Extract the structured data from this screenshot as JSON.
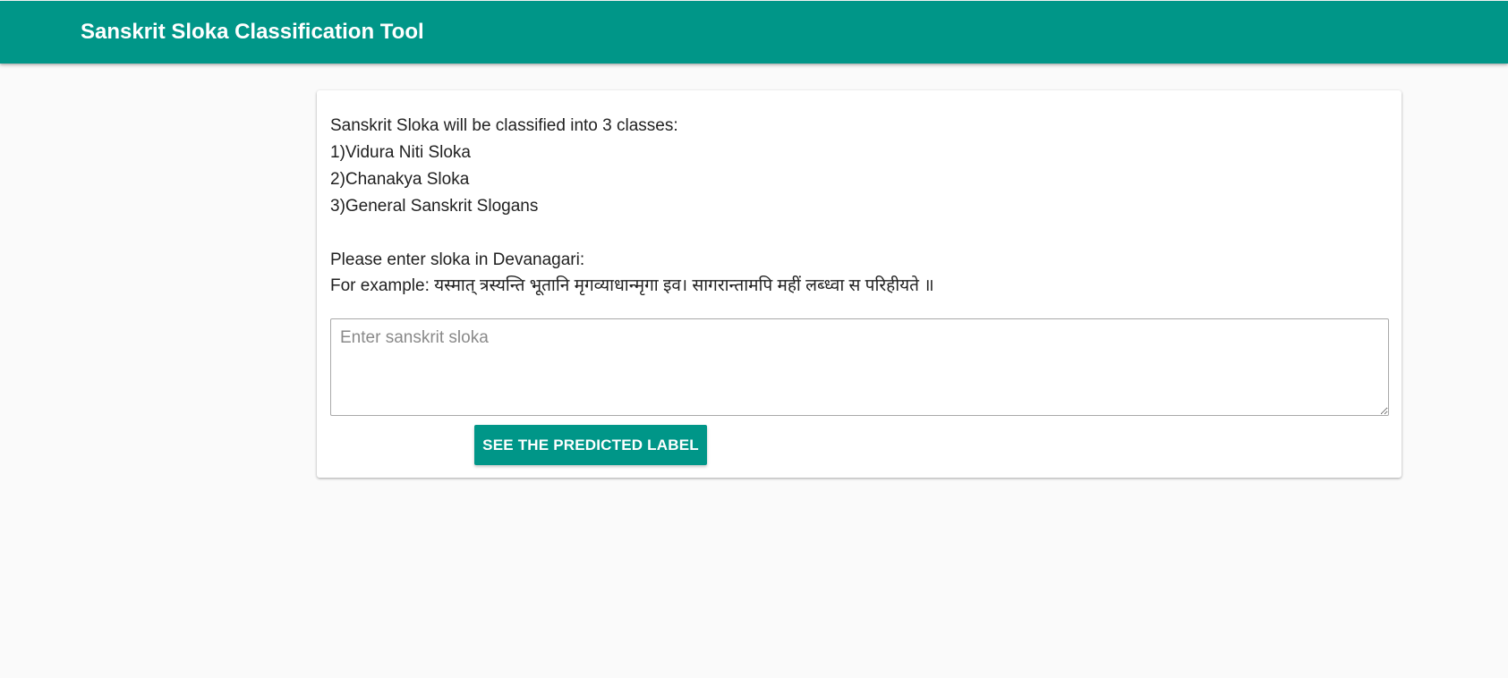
{
  "header": {
    "title": "Sanskrit Sloka Classification Tool",
    "accent_color": "#009688"
  },
  "card": {
    "intro": "Sanskrit Sloka will be classified into 3 classes:",
    "classes": [
      "1)Vidura Niti Sloka",
      "2)Chanakya Sloka",
      "3)General Sanskrit Slogans"
    ],
    "instruction": "Please enter sloka in Devanagari:",
    "example": "For example: यस्मात् त्रस्यन्ति भूतानि मृगव्याधान्मृगा इव। सागरान्तामपि महीं लब्ध्वा स परिहीयते ॥",
    "input": {
      "value": "",
      "placeholder": "Enter sanskrit sloka"
    },
    "button_label": "SEE THE PREDICTED LABEL"
  }
}
